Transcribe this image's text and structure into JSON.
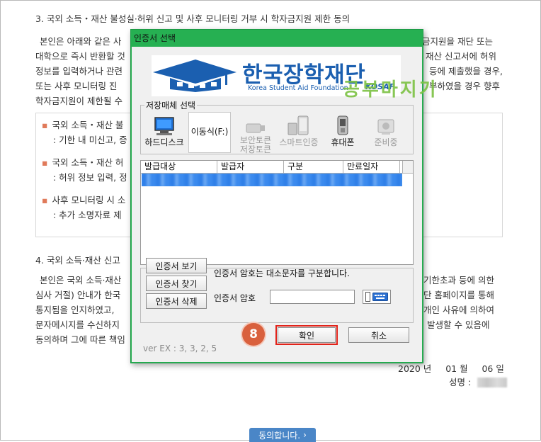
{
  "document": {
    "section3_title": "3. 국외 소득・재산 불성실·허위 신고 및 사후 모니터링 거부 시 학자금지원 제한 동의",
    "p3_line1_left": "본인은 아래와 같은 사",
    "p3_line1_right": "금지원을 재단 또는",
    "p3_line2_left": "대학으로 즉시 반환할 것",
    "p3_line2_right": "재산 신고서에 허위",
    "p3_line3_left": "정보를 입력하거나 관련",
    "p3_line3_right": "등에 제출했을 경우,",
    "p3_line4_left": "또는 사후 모니터링 진",
    "p3_line4_right": "부하였을 경우 향후",
    "p3_line5_left": "학자금지원이 제한될 수",
    "bullet1_head": "국외 소득・재산 불",
    "bullet1_sub": ": 기한 내 미신고, 증",
    "bullet2_head": "국외 소득・재산 허",
    "bullet2_sub": ": 허위 정보 입력, 정",
    "bullet3_head": "사후 모니터링 시 소",
    "bullet3_sub": ": 추가 소명자료 제",
    "section4_title": "4. 국외 소득·재산 신고",
    "p4_line1_left": "본인은 국외 소득·재산",
    "p4_line1_right": "기한초과 등에 의한",
    "p4_line2_left": "심사 거절) 안내가 한국",
    "p4_line2_right": "단 홈페이지를 통해",
    "p4_line3_left": "통지됨을 인지하였고,",
    "p4_line3_right": "개인 사유에 의하여",
    "p4_line4_left": "문자메시지를 수신하지",
    "p4_line4_right": "발생할 수 있음에",
    "p4_line5_left": "동의하며 그에 따른 책임",
    "date_year": "2020",
    "date_year_unit": "년",
    "date_month": "01",
    "date_month_unit": "월",
    "date_day": "06",
    "date_day_unit": "일",
    "name_label": "성명 :",
    "agree_button": "동의합니다.",
    "agree_arrow": "›"
  },
  "dialog": {
    "title": "인증서 선택",
    "banner_ko": "한국장학재단",
    "banner_en": "Korea Student Aid Foundation",
    "banner_abbr": "KOSAF",
    "storage_legend": "저장매체 선택",
    "media": [
      {
        "label": "하드디스크",
        "icon": "monitor-icon",
        "enabled": true
      },
      {
        "label": "이동식(F:)",
        "icon": "removable-disk-icon",
        "enabled": true
      },
      {
        "label": "보안토큰",
        "label2": "저장토큰",
        "icon": "usb-token-icon",
        "enabled": false
      },
      {
        "label": "스마트인증",
        "icon": "smart-auth-icon",
        "enabled": false
      },
      {
        "label": "휴대폰",
        "icon": "mobile-phone-icon",
        "enabled": true
      },
      {
        "label": "준비중",
        "icon": "lock-card-icon",
        "enabled": false
      }
    ],
    "list_headers": [
      "발급대상",
      "발급자",
      "구분",
      "만료일자"
    ],
    "view_cert_button": "인증서 보기",
    "find_cert_button": "인증서 찾기",
    "delete_cert_button": "인증서 삭제",
    "case_note": "인증서 암호는 대소문자를 구분합니다.",
    "password_label": "인증서 암호",
    "password_value": "",
    "confirm_button": "확인",
    "cancel_button": "취소",
    "version": "ver EX : 3, 3, 2, 5"
  },
  "annotation": {
    "step_number": "8",
    "highlight_color": "#e2231a",
    "badge_color": "#d9603d"
  },
  "watermark": "공부마지기",
  "colors": {
    "dialog_title_bar": "#26b052",
    "brand_blue": "#1b5fb0",
    "selected_row": "#3e8ff0",
    "agree_button": "#4a86c7"
  }
}
